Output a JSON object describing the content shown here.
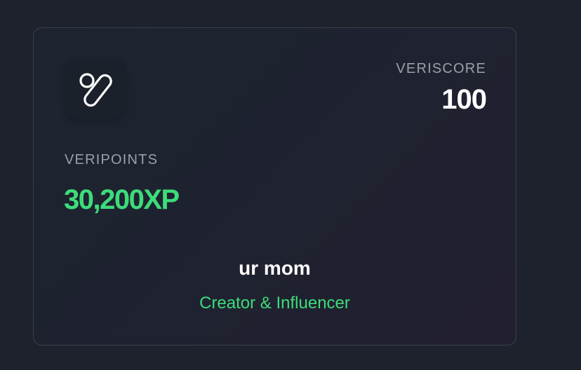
{
  "card": {
    "logo_icon": "veri-logo-icon",
    "veriscore": {
      "label": "VERISCORE",
      "value": "100"
    },
    "veripoints": {
      "label": "VERIPOINTS",
      "value": "30,200XP"
    },
    "user": {
      "name": "ur mom",
      "role": "Creator & Influencer"
    }
  },
  "colors": {
    "background": "#1e222d",
    "card_border": "#3a3f4b",
    "label_gray": "#9aa0aa",
    "accent_green": "#3ddc7a",
    "text_white": "#ffffff"
  }
}
